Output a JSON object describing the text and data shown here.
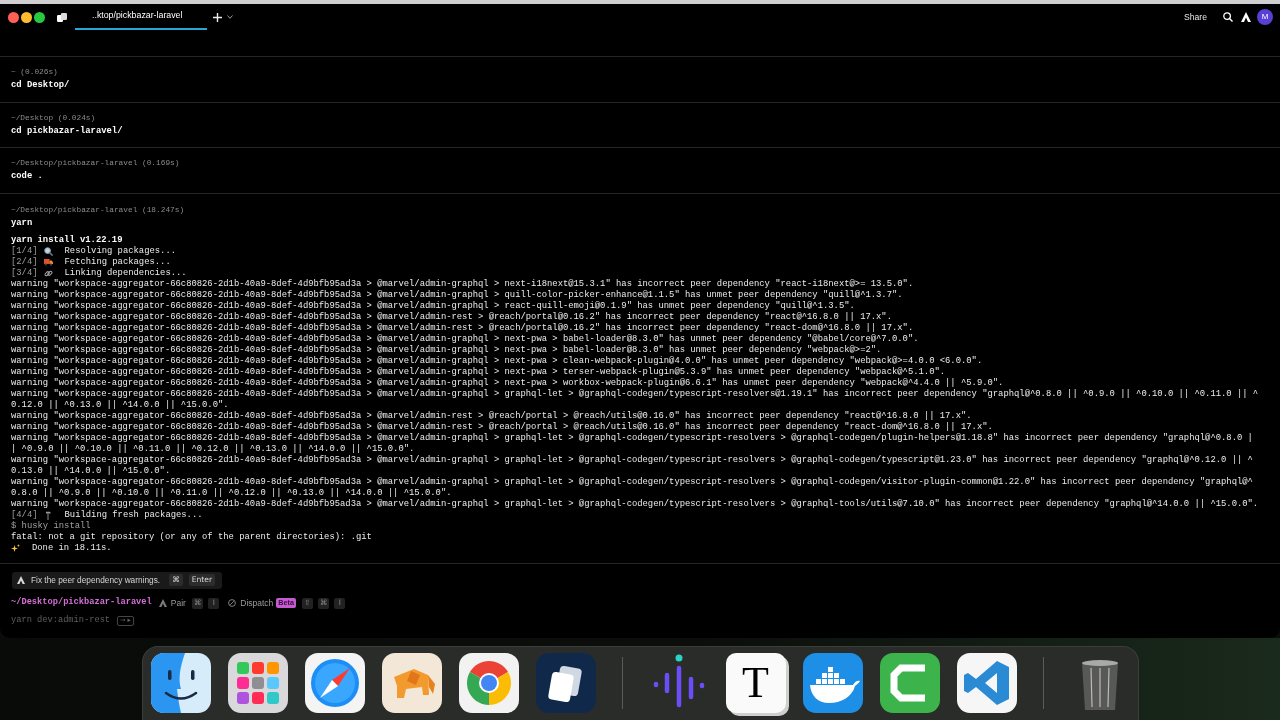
{
  "tabs": [
    {
      "title": "..ktop/pickbazar-laravel",
      "selected": true
    }
  ],
  "toolbar": {
    "share": "Share",
    "avatar_initial": "M"
  },
  "blocks": [
    {
      "header": "~ (0.026s)",
      "command": "cd Desktop/"
    },
    {
      "header": "~/Desktop (0.024s)",
      "command": "cd pickbazar-laravel/"
    },
    {
      "header": "~/Desktop/pickbazar-laravel (0.169s)",
      "command": "code ."
    },
    {
      "header": "~/Desktop/pickbazar-laravel (18.247s)",
      "command": "yarn",
      "output": [
        {
          "kind": "bold",
          "text": "yarn install v1.22.19"
        },
        {
          "kind": "step",
          "step": "[1/4]",
          "text": "Resolving packages..."
        },
        {
          "kind": "step",
          "step": "[2/4]",
          "text": "Fetching packages..."
        },
        {
          "kind": "step",
          "step": "[3/4]",
          "text": "Linking dependencies..."
        },
        {
          "kind": "plain",
          "text": "warning \"workspace-aggregator-66c80826-2d1b-40a9-8def-4d9bfb95ad3a > @marvel/admin-graphql > next-i18next@15.3.1\" has incorrect peer dependency \"react-i18next@>= 13.5.0\"."
        },
        {
          "kind": "plain",
          "text": "warning \"workspace-aggregator-66c80826-2d1b-40a9-8def-4d9bfb95ad3a > @marvel/admin-graphql > quill-color-picker-enhance@1.1.5\" has unmet peer dependency \"quill@^1.3.7\"."
        },
        {
          "kind": "plain",
          "text": "warning \"workspace-aggregator-66c80826-2d1b-40a9-8def-4d9bfb95ad3a > @marvel/admin-graphql > react-quill-emoji@0.1.9\" has unmet peer dependency \"quill@^1.3.5\"."
        },
        {
          "kind": "plain",
          "text": "warning \"workspace-aggregator-66c80826-2d1b-40a9-8def-4d9bfb95ad3a > @marvel/admin-rest > @reach/portal@0.16.2\" has incorrect peer dependency \"react@^16.8.0 || 17.x\"."
        },
        {
          "kind": "plain",
          "text": "warning \"workspace-aggregator-66c80826-2d1b-40a9-8def-4d9bfb95ad3a > @marvel/admin-rest > @reach/portal@0.16.2\" has incorrect peer dependency \"react-dom@^16.8.0 || 17.x\"."
        },
        {
          "kind": "plain",
          "text": "warning \"workspace-aggregator-66c80826-2d1b-40a9-8def-4d9bfb95ad3a > @marvel/admin-graphql > next-pwa > babel-loader@8.3.0\" has unmet peer dependency \"@babel/core@^7.0.0\"."
        },
        {
          "kind": "plain",
          "text": "warning \"workspace-aggregator-66c80826-2d1b-40a9-8def-4d9bfb95ad3a > @marvel/admin-graphql > next-pwa > babel-loader@8.3.0\" has unmet peer dependency \"webpack@>=2\"."
        },
        {
          "kind": "plain",
          "text": "warning \"workspace-aggregator-66c80826-2d1b-40a9-8def-4d9bfb95ad3a > @marvel/admin-graphql > next-pwa > clean-webpack-plugin@4.0.0\" has unmet peer dependency \"webpack@>=4.0.0 <6.0.0\"."
        },
        {
          "kind": "plain",
          "text": "warning \"workspace-aggregator-66c80826-2d1b-40a9-8def-4d9bfb95ad3a > @marvel/admin-graphql > next-pwa > terser-webpack-plugin@5.3.9\" has unmet peer dependency \"webpack@^5.1.0\"."
        },
        {
          "kind": "plain",
          "text": "warning \"workspace-aggregator-66c80826-2d1b-40a9-8def-4d9bfb95ad3a > @marvel/admin-graphql > next-pwa > workbox-webpack-plugin@6.6.1\" has unmet peer dependency \"webpack@^4.4.0 || ^5.9.0\"."
        },
        {
          "kind": "plain",
          "text": "warning \"workspace-aggregator-66c80826-2d1b-40a9-8def-4d9bfb95ad3a > @marvel/admin-graphql > graphql-let > @graphql-codegen/typescript-resolvers@1.19.1\" has incorrect peer dependency \"graphql@^0.8.0 || ^0.9.0 || ^0.10.0 || ^0.11.0 || ^0.12.0 || ^0.13.0 || ^14.0.0 || ^15.0.0\"."
        },
        {
          "kind": "plain",
          "text": "warning \"workspace-aggregator-66c80826-2d1b-40a9-8def-4d9bfb95ad3a > @marvel/admin-rest > @reach/portal > @reach/utils@0.16.0\" has incorrect peer dependency \"react@^16.8.0 || 17.x\"."
        },
        {
          "kind": "plain",
          "text": "warning \"workspace-aggregator-66c80826-2d1b-40a9-8def-4d9bfb95ad3a > @marvel/admin-rest > @reach/portal > @reach/utils@0.16.0\" has incorrect peer dependency \"react-dom@^16.8.0 || 17.x\"."
        },
        {
          "kind": "plain",
          "text": "warning \"workspace-aggregator-66c80826-2d1b-40a9-8def-4d9bfb95ad3a > @marvel/admin-graphql > graphql-let > @graphql-codegen/typescript-resolvers > @graphql-codegen/plugin-helpers@1.18.8\" has incorrect peer dependency \"graphql@^0.8.0 || ^0.9.0 || ^0.10.0 || ^0.11.0 || ^0.12.0 || ^0.13.0 || ^14.0.0 || ^15.0.0\"."
        },
        {
          "kind": "plain",
          "text": "warning \"workspace-aggregator-66c80826-2d1b-40a9-8def-4d9bfb95ad3a > @marvel/admin-graphql > graphql-let > @graphql-codegen/typescript-resolvers > @graphql-codegen/typescript@1.23.0\" has incorrect peer dependency \"graphql@^0.12.0 || ^0.13.0 || ^14.0.0 || ^15.0.0\"."
        },
        {
          "kind": "plain",
          "text": "warning \"workspace-aggregator-66c80826-2d1b-40a9-8def-4d9bfb95ad3a > @marvel/admin-graphql > graphql-let > @graphql-codegen/typescript-resolvers > @graphql-codegen/visitor-plugin-common@1.22.0\" has incorrect peer dependency \"graphql@^0.8.0 || ^0.9.0 || ^0.10.0 || ^0.11.0 || ^0.12.0 || ^0.13.0 || ^14.0.0 || ^15.0.0\"."
        },
        {
          "kind": "plain",
          "text": "warning \"workspace-aggregator-66c80826-2d1b-40a9-8def-4d9bfb95ad3a > @marvel/admin-graphql > graphql-let > @graphql-codegen/typescript-resolvers > @graphql-tools/utils@7.10.0\" has incorrect peer dependency \"graphql@^14.0.0 || ^15.0.0\"."
        },
        {
          "kind": "step",
          "step": "[4/4]",
          "text": "Building fresh packages..."
        },
        {
          "kind": "dim",
          "text": "$ husky install"
        },
        {
          "kind": "plain",
          "text": "fatal: not a git repository (or any of the parent directories): .git"
        },
        {
          "kind": "done",
          "text": "Done in 18.11s."
        }
      ]
    }
  ],
  "suggestion": {
    "text": "Fix the peer dependency warnings.",
    "keys": [
      "⌘",
      "Enter"
    ]
  },
  "prompt": {
    "path": "~/Desktop/pickbazar-laravel",
    "actions": [
      {
        "kind": "pair",
        "label": "Pair",
        "keys": [
          "⌘",
          "I"
        ]
      },
      {
        "kind": "dispatch",
        "label": "Dispatch",
        "badge": "Beta",
        "keys": [
          "⇧",
          "⌘",
          "I"
        ]
      }
    ]
  },
  "input": {
    "placeholder": "yarn dev:admin-rest",
    "accept_hint": "→ ▸"
  },
  "dock": {
    "items": [
      {
        "kind": "face"
      },
      {
        "kind": "grid"
      },
      {
        "kind": "compass"
      },
      {
        "kind": "elephant"
      },
      {
        "kind": "ring"
      },
      {
        "kind": "cards"
      },
      {
        "kind": "separator"
      },
      {
        "kind": "waveform"
      },
      {
        "kind": "letter",
        "letter": "T"
      },
      {
        "kind": "whale"
      },
      {
        "kind": "bracket"
      },
      {
        "kind": "ribbon"
      },
      {
        "kind": "separator"
      },
      {
        "kind": "trash"
      }
    ]
  }
}
